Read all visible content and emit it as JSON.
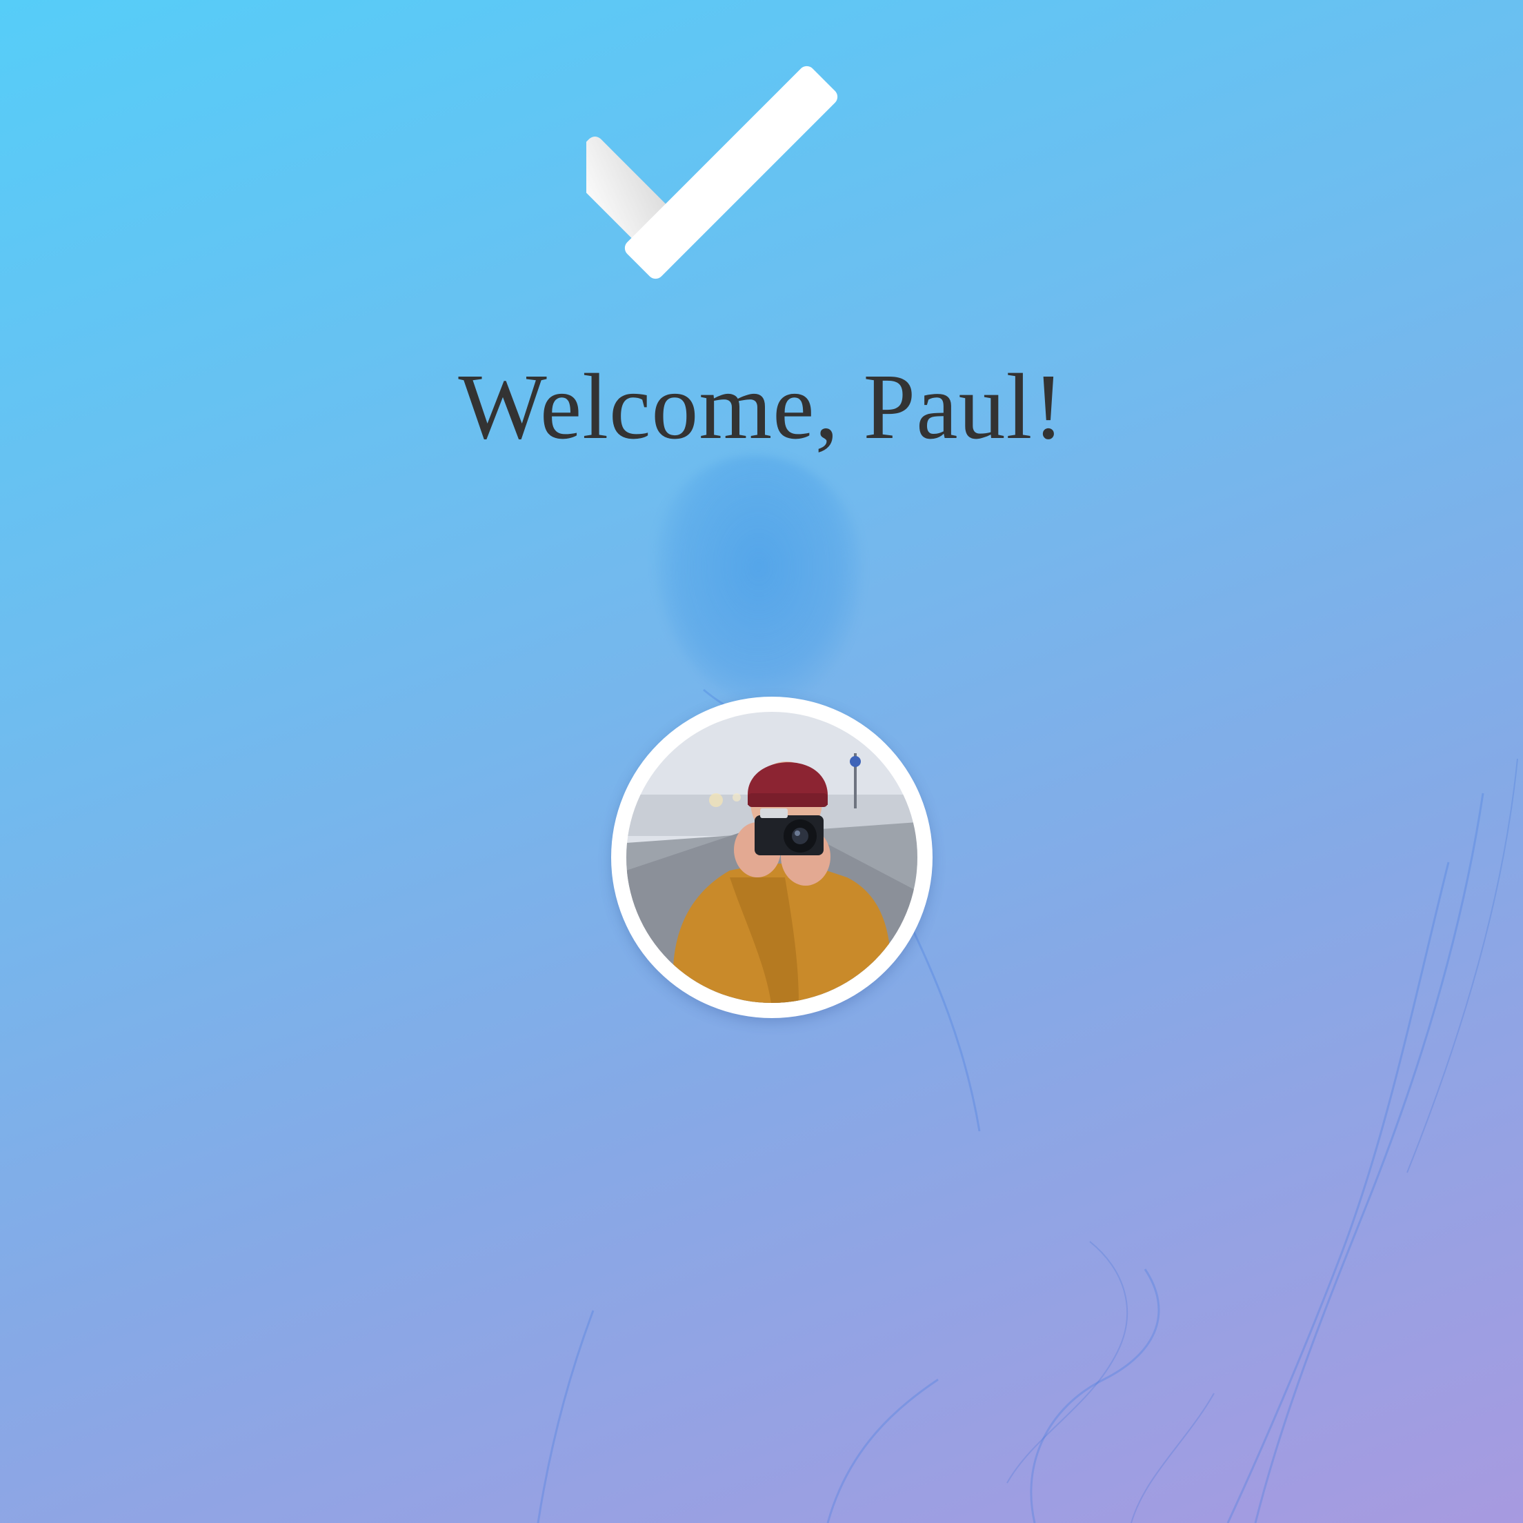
{
  "welcome": {
    "title": "Welcome, Paul!"
  },
  "icons": {
    "status": "checkmark-icon"
  },
  "avatar": {
    "description": "profile-photo"
  },
  "colors": {
    "gradient_start": "#56cdf8",
    "gradient_end": "#a79ae0",
    "text": "#333333",
    "check": "#ffffff"
  }
}
